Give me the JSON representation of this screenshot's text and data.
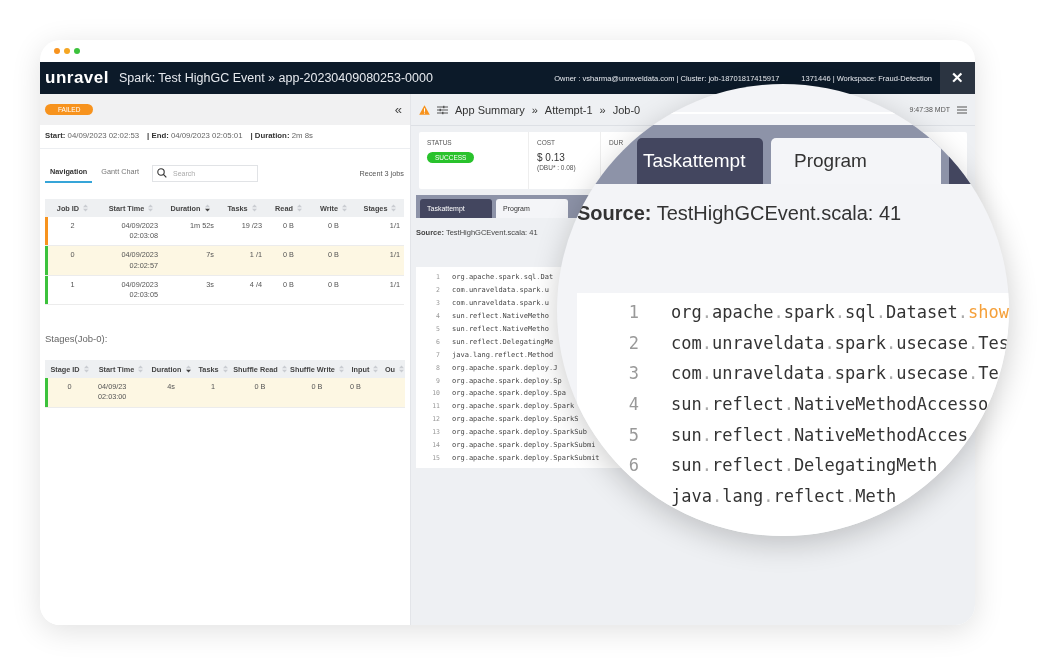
{
  "header": {
    "logo": "unravel",
    "title": "Spark: Test HighGC Event » app-20230409080253-0000",
    "meta": [
      "Owner : vsharma@unraveldata.com | Cluster: job-18701817415917",
      "1371446 | Workspace: Fraud-Detection"
    ],
    "close": "✕"
  },
  "left": {
    "status": "FAILED",
    "collapse": "«",
    "times": [
      "**Start:** 04/09/2023 02:02:53",
      "**| End:** 04/09/2023 02:05:01",
      "**| Duration:** 2m 8s"
    ],
    "tabs": [
      {
        "label": "Navigation",
        "selected": true
      },
      {
        "label": "Gantt Chart",
        "selected": false
      }
    ],
    "search": {
      "placeholder": "Search"
    },
    "recent": "Recent 3 jobs",
    "jobs": {
      "columns": [
        {
          "label": "Job ID",
          "sorted": false
        },
        {
          "label": "Start Time",
          "sorted": false
        },
        {
          "label": "Duration",
          "sorted": true
        },
        {
          "label": "Tasks",
          "sorted": false
        },
        {
          "label": "Read",
          "sorted": false
        },
        {
          "label": "Write",
          "sorted": false
        },
        {
          "label": "Stages",
          "sorted": false
        }
      ],
      "rows": [
        {
          "color": "#f7931e",
          "selected": false,
          "cells": [
            "2",
            "04/09/2023\n02:03:08",
            "1m 52s",
            "19 /23",
            "0 B",
            "0 B",
            "1/1"
          ]
        },
        {
          "color": "#3cc23c",
          "selected": true,
          "cells": [
            "0",
            "04/09/2023\n02:02:57",
            "7s",
            "1 /1",
            "0 B",
            "0 B",
            "1/1"
          ]
        },
        {
          "color": "#3cc23c",
          "selected": false,
          "cells": [
            "1",
            "04/09/2023\n02:03:05",
            "3s",
            "4 /4",
            "0 B",
            "0 B",
            "1/1"
          ]
        }
      ]
    },
    "stages_title": "Stages(Job-0):",
    "stages": {
      "columns": [
        {
          "label": "Stage ID",
          "sorted": false
        },
        {
          "label": "Start Time",
          "sorted": false
        },
        {
          "label": "Duration",
          "sorted": true
        },
        {
          "label": "Tasks",
          "sorted": false
        },
        {
          "label": "Shuffle Read",
          "sorted": false
        },
        {
          "label": "Shuffle Write",
          "sorted": false
        },
        {
          "label": "Input",
          "sorted": false
        },
        {
          "label": "Ou",
          "sorted": false
        }
      ],
      "rows": [
        {
          "color": "#3cc23c",
          "selected": true,
          "cells": [
            "0",
            "04/09/23\n02:03:00",
            "4s",
            "1",
            "0 B",
            "0 B",
            "0 B"
          ]
        }
      ]
    }
  },
  "right": {
    "breadcrumb": [
      "App Summary",
      "»",
      "Attempt-1",
      "»",
      "Job-0"
    ],
    "time": "9:47:38 MDT",
    "stats": [
      {
        "kind": "badge",
        "label": "STATUS",
        "value": "SUCCESS"
      },
      {
        "kind": "amount",
        "label": "COST",
        "value": "$ 0.13",
        "note": "(DBU* : 0.08)"
      },
      {
        "kind": "label",
        "label": "DUR"
      }
    ],
    "tabs": [
      {
        "label": "Taskattempt",
        "selected": false
      },
      {
        "label": "Program",
        "selected": true
      }
    ],
    "source": "**Source:** TestHighGCEvent.scala: 41",
    "code": [
      {
        "n": "1",
        "text": "org.apache.spark.sql.Dat"
      },
      {
        "n": "2",
        "text": "com.unraveldata.spark.u"
      },
      {
        "n": "3",
        "text": "com.unraveldata.spark.u"
      },
      {
        "n": "4",
        "text": "sun.reflect.NativeMetho"
      },
      {
        "n": "5",
        "text": "sun.reflect.NativeMetho"
      },
      {
        "n": "6",
        "text": "sun.reflect.DelegatingMe"
      },
      {
        "n": "7",
        "text": "java.lang.reflect.Method"
      },
      {
        "n": "8",
        "text": "org.apache.spark.deploy.J"
      },
      {
        "n": "9",
        "text": "org.apache.spark.deploy.Sp"
      },
      {
        "n": "10",
        "text": "org.apache.spark.deploy.Spa"
      },
      {
        "n": "11",
        "text": "org.apache.spark.deploy.Spark"
      },
      {
        "n": "12",
        "text": "org.apache.spark.deploy.SparkS"
      },
      {
        "n": "13",
        "text": "org.apache.spark.deploy.SparkSub"
      },
      {
        "n": "14",
        "text": "org.apache.spark.deploy.SparkSubmi"
      },
      {
        "n": "15",
        "text": "org.apache.spark.deploy.SparkSubmit"
      }
    ]
  },
  "magnifier": {
    "tabs": [
      {
        "label": "Taskattempt",
        "selected": false
      },
      {
        "label": "Program",
        "selected": true
      }
    ],
    "source": "**Source:** TestHighGCEvent.scala: 41",
    "code": [
      {
        "n": "1",
        "text": "org.apache.spark.sql.Dataset.",
        "method": "show"
      },
      {
        "n": "2",
        "text": "com.unraveldata.spark.usecase.Tes"
      },
      {
        "n": "3",
        "text": "com.unraveldata.spark.usecase.Te"
      },
      {
        "n": "4",
        "text": "sun.reflect.NativeMethodAccesso"
      },
      {
        "n": "5",
        "text": "sun.reflect.NativeMethodAcces"
      },
      {
        "n": "6",
        "text": "sun.reflect.DelegatingMeth"
      },
      {
        "text": "java.lang.reflect.Meth"
      }
    ]
  }
}
